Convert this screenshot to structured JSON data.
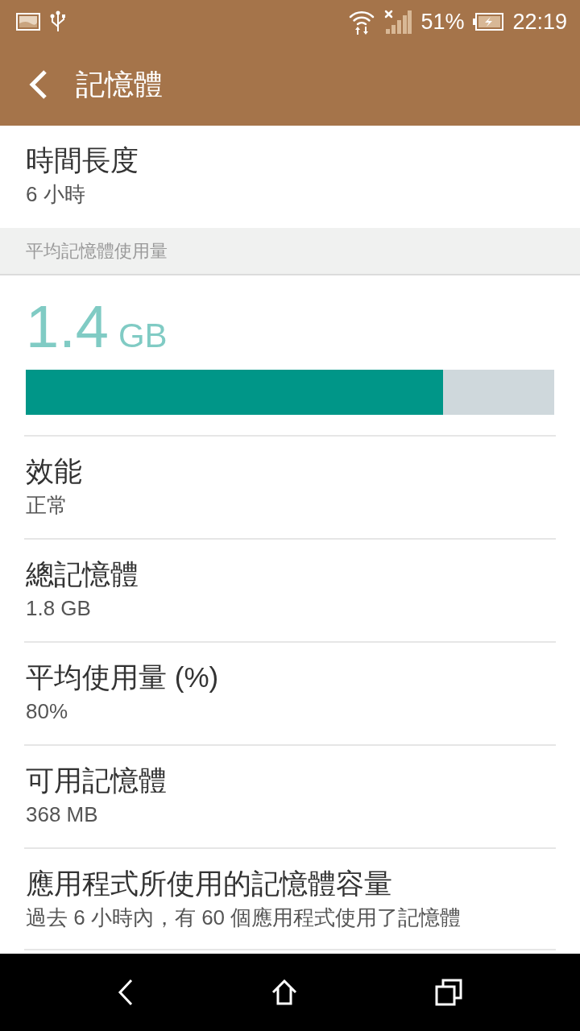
{
  "status_bar": {
    "battery_percent": "51%",
    "time": "22:19"
  },
  "app_bar": {
    "title": "記憶體"
  },
  "duration": {
    "title": "時間長度",
    "value": "6 小時"
  },
  "section_header": "平均記憶體使用量",
  "usage": {
    "amount": "1.4",
    "unit": "GB",
    "level": 0.79
  },
  "items": [
    {
      "title": "效能",
      "value": "正常"
    },
    {
      "title": "總記憶體",
      "value": "1.8 GB"
    },
    {
      "title": "平均使用量 (%)",
      "value": "80%"
    },
    {
      "title": "可用記憶體",
      "value": "368 MB"
    },
    {
      "title": "應用程式所使用的記憶體容量",
      "value": "過去 6 小時內，有 60 個應用程式使用了記憶體"
    }
  ]
}
